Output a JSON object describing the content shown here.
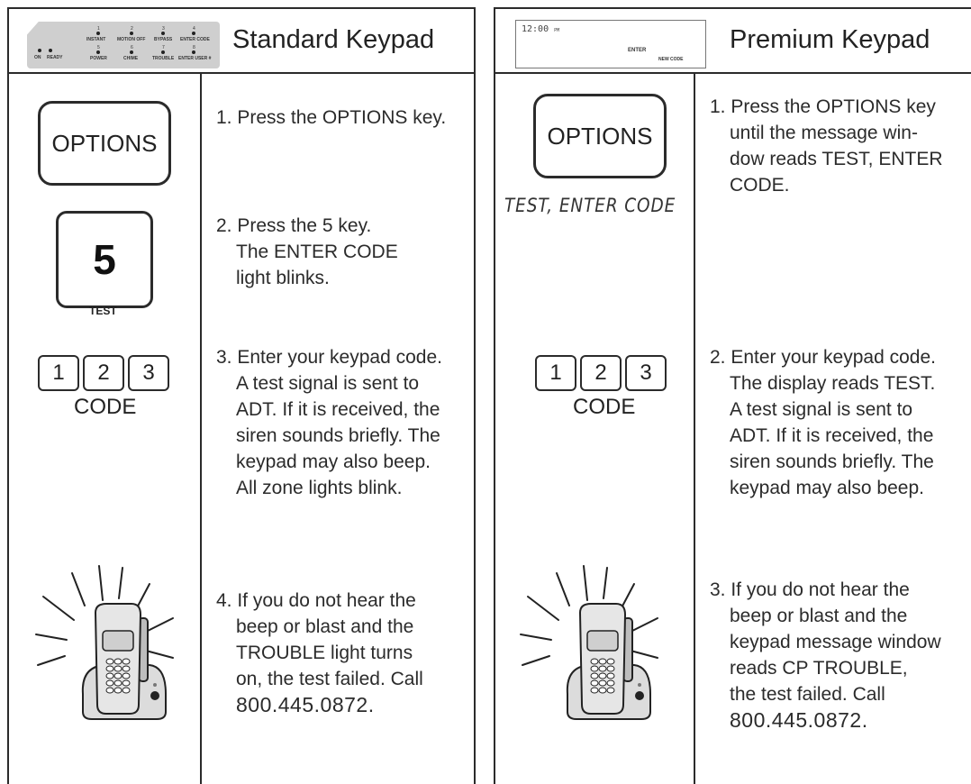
{
  "standard": {
    "title": "Standard Keypad",
    "strip": {
      "on": "ON",
      "ready": "READY",
      "top_numbers": [
        "1",
        "2",
        "3",
        "4"
      ],
      "top_labels": [
        "INSTANT",
        "MOTION OFF",
        "BYPASS",
        "ENTER CODE"
      ],
      "bottom_numbers": [
        "5",
        "6",
        "7",
        "8"
      ],
      "bottom_labels": [
        "POWER",
        "CHIME",
        "TROUBLE",
        "ENTER USER #"
      ]
    },
    "options_key": "OPTIONS",
    "five_key": "5",
    "five_sublabel": "TEST",
    "code_keys": [
      "1",
      "2",
      "3"
    ],
    "code_label": "CODE",
    "steps": [
      [
        "1. Press the OPTIONS key."
      ],
      [
        "2. Press the 5 key.",
        "The ENTER CODE",
        "light blinks."
      ],
      [
        "3. Enter your keypad code.",
        "A test signal is sent to",
        "ADT. If it is received, the",
        "siren sounds briefly. The",
        "keypad may also beep.",
        "All zone lights blink."
      ],
      [
        "4. If you do not hear the",
        "beep or blast and the",
        "TROUBLE light turns",
        "on, the test failed. Call",
        "800.445.0872."
      ]
    ]
  },
  "premium": {
    "title": "Premium Keypad",
    "lcd": {
      "time": "12:00",
      "pm": "PM",
      "enter": "ENTER",
      "new_code": "NEW CODE"
    },
    "options_key": "OPTIONS",
    "lcd_message": "TEST, ENTER CODE",
    "code_keys": [
      "1",
      "2",
      "3"
    ],
    "code_label": "CODE",
    "steps": [
      [
        "1. Press the OPTIONS key",
        "until the message win-",
        "dow reads TEST, ENTER",
        "CODE."
      ],
      [
        "2. Enter your keypad code.",
        "The display reads TEST.",
        "A test signal is sent to",
        "ADT. If it is received, the",
        "siren sounds briefly. The",
        "keypad may also beep."
      ],
      [
        "3. If you do not hear the",
        "beep or blast and the",
        "keypad message window",
        "reads CP TROUBLE,",
        "the test failed. Call",
        "800.445.0872."
      ]
    ]
  }
}
